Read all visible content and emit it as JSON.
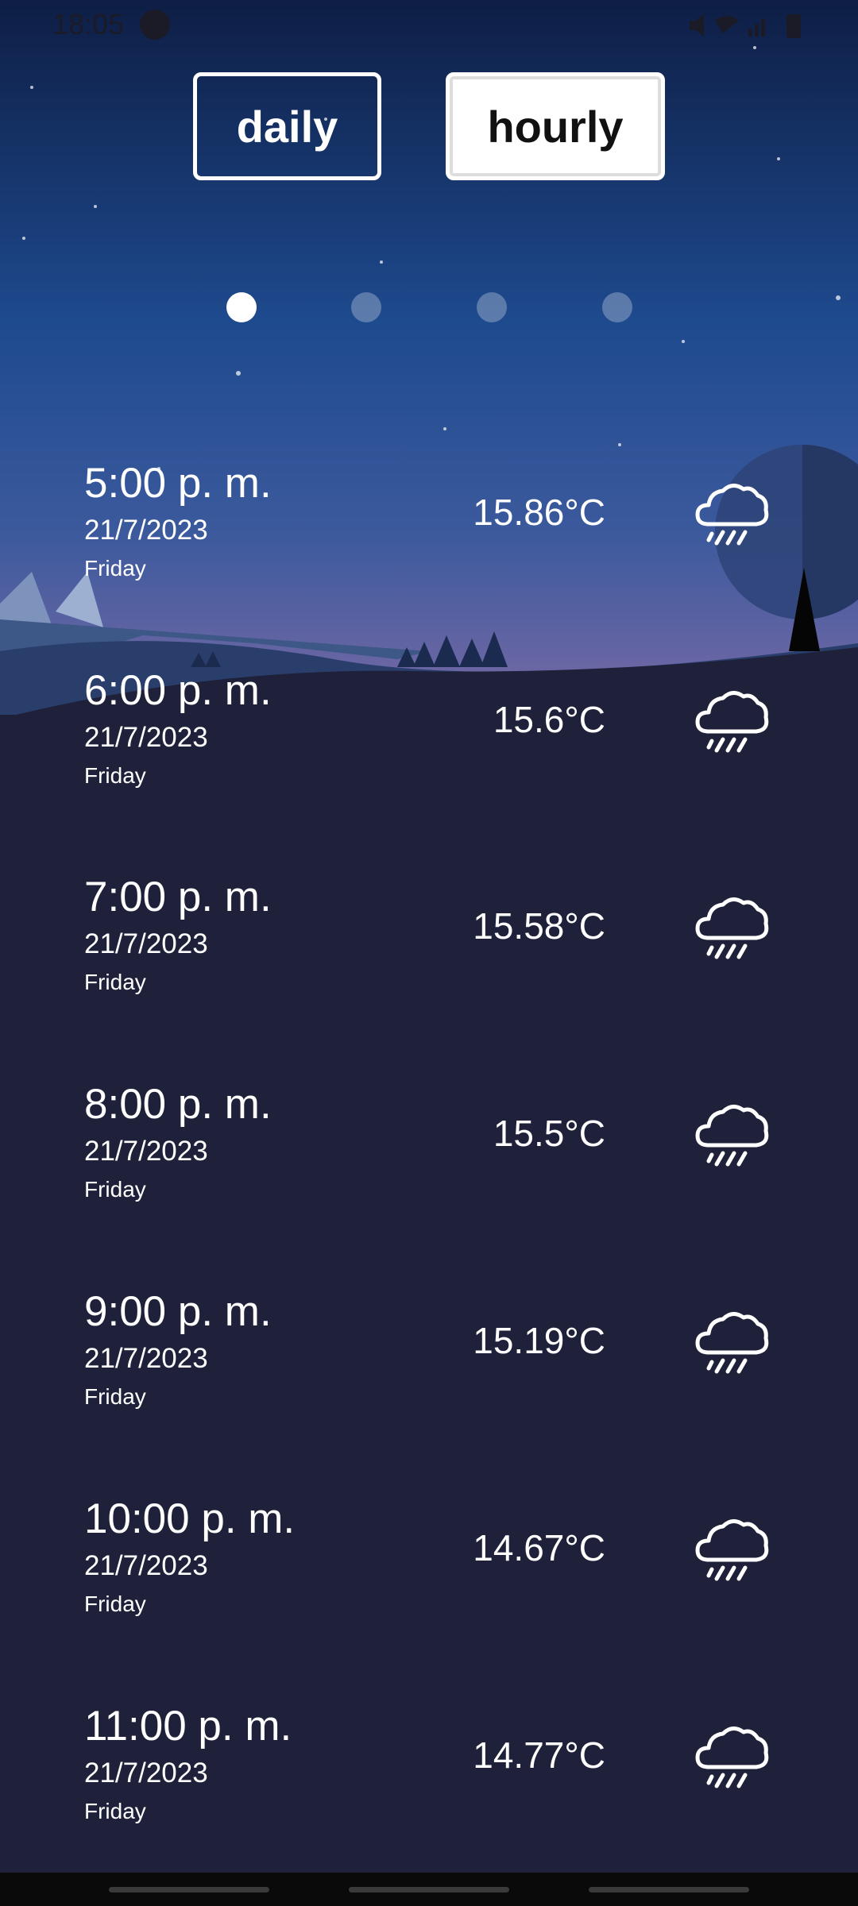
{
  "status_bar": {
    "time": "18:05"
  },
  "tabs": {
    "daily_label": "daily",
    "hourly_label": "hourly",
    "selected": "hourly"
  },
  "pager": {
    "total": 4,
    "active_index": 0
  },
  "hours": [
    {
      "time": "5:00 p. m.",
      "date": "21/7/2023",
      "day": "Friday",
      "temp": "15.86°C",
      "icon": "rain-cloud-icon"
    },
    {
      "time": "6:00 p. m.",
      "date": "21/7/2023",
      "day": "Friday",
      "temp": "15.6°C",
      "icon": "rain-cloud-icon"
    },
    {
      "time": "7:00 p. m.",
      "date": "21/7/2023",
      "day": "Friday",
      "temp": "15.58°C",
      "icon": "rain-cloud-icon"
    },
    {
      "time": "8:00 p. m.",
      "date": "21/7/2023",
      "day": "Friday",
      "temp": "15.5°C",
      "icon": "rain-cloud-icon"
    },
    {
      "time": "9:00 p. m.",
      "date": "21/7/2023",
      "day": "Friday",
      "temp": "15.19°C",
      "icon": "rain-cloud-icon"
    },
    {
      "time": "10:00 p. m.",
      "date": "21/7/2023",
      "day": "Friday",
      "temp": "14.67°C",
      "icon": "rain-cloud-icon"
    },
    {
      "time": "11:00 p. m.",
      "date": "21/7/2023",
      "day": "Friday",
      "temp": "14.77°C",
      "icon": "rain-cloud-icon"
    }
  ],
  "colors": {
    "sky_top": "#0d1b3d",
    "sky_mid": "#1f4a8f",
    "horizon": "#7e6aa6",
    "ground": "#1e2139",
    "accent_white": "#ffffff"
  }
}
